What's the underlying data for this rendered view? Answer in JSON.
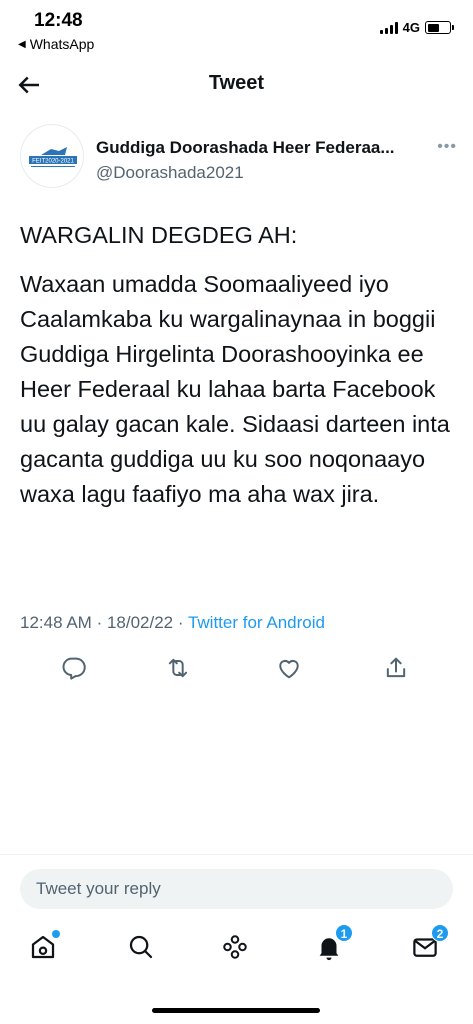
{
  "status_bar": {
    "time": "12:48",
    "back_app": "WhatsApp",
    "network": "4G"
  },
  "header": {
    "title": "Tweet"
  },
  "author": {
    "name": "Guddiga Doorashada Heer Federaa...",
    "handle": "@Doorashada2021",
    "avatar_text": "FEIT2020-2021"
  },
  "tweet": {
    "heading": "WARGALIN DEGDEG AH:",
    "body": "Waxaan umadda Soomaaliyeed iyo Caalamkaba ku wargalinaynaa in boggii Guddiga Hirgelinta Doorashooyinka ee Heer Federaal ku lahaa barta Facebook uu galay gacan kale. Sidaasi darteen inta gacanta guddiga uu ku soo noqonaayo waxa lagu faafiyo ma aha wax jira.",
    "time": "12:48 AM",
    "date": "18/02/22",
    "source": "Twitter for Android"
  },
  "actions": [
    "reply-icon",
    "retweet-icon",
    "like-icon",
    "share-icon"
  ],
  "reply": {
    "placeholder": "Tweet your reply"
  },
  "nav": {
    "items": [
      "home-icon",
      "search-icon",
      "spaces-icon",
      "notifications-icon",
      "messages-icon"
    ],
    "notifications_badge": "1",
    "messages_badge": "2"
  },
  "colors": {
    "accent": "#1d9bf0",
    "text": "#0f1419",
    "secondary": "#536471"
  }
}
